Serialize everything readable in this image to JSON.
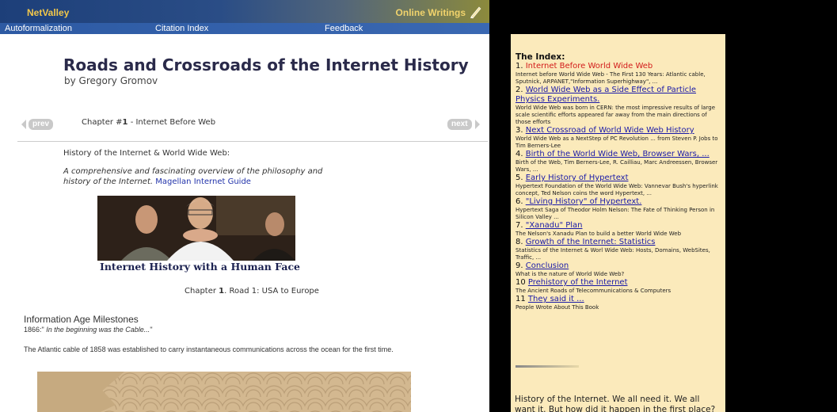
{
  "header": {
    "brand": "NetValley",
    "online_writings": "Online Writings"
  },
  "menu": [
    {
      "label": "Autoformalization"
    },
    {
      "label": "Citation Index"
    },
    {
      "label": "Feedback"
    }
  ],
  "article": {
    "title": "Roads and Crossroads of the Internet History",
    "byline": "by Gregory Gromov",
    "prev_label": "prev",
    "next_label": "next",
    "chapter_prefix": "Chapter #",
    "chapter_num": "1",
    "chapter_title": " - Internet Before Web",
    "history_heading": "History of the Internet & World Wide Web:",
    "quote_text": "A comprehensive and fascinating overview of the philosophy and history of the Internet.",
    "quote_source": "Magellan Internet Guide",
    "photo_caption": "Internet History with a Human Face",
    "road_prefix": "Chapter ",
    "road_num": "1",
    "road_suffix": ". Road 1: USA to Europe",
    "milestones_heading": "Information Age Milestones",
    "milestones_year": "1866:\"",
    "milestones_quote": " In the beginning was the Cable...",
    "milestones_close": "\"",
    "atlantic_text": "The Atlantic cable of 1858 was established to carry instantaneous communications across the ocean for the first time."
  },
  "index": {
    "title": "The Index:",
    "items": [
      {
        "num": "1. ",
        "label": "Internet Before World Wide Web",
        "active": true,
        "desc": "Internet before World Wide Web - The First 130 Years: Atlantic cable, Sputnick, ARPANET,\"Information Superhighway\", ..."
      },
      {
        "num": "2. ",
        "label": "World Wide Web as a Side Effect of Particle Physics Experiments.",
        "active": false,
        "desc": "World Wide Web was born in CERN: the most impressive results of large scale scientific efforts appeared far away from the main directions of those efforts"
      },
      {
        "num": "3. ",
        "label": "Next Crossroad of World Wide Web History",
        "active": false,
        "desc": "World Wide Web as a NextStep of PC Revolution ... from Steven P. Jobs to Tim Berners-Lee"
      },
      {
        "num": "4. ",
        "label": "Birth of the World Wide Web, Browser Wars, ...",
        "active": false,
        "desc": "Birth of the Web, Tim Berners-Lee, R. Cailliau, Marc Andreessen, Browser Wars, ..."
      },
      {
        "num": "5. ",
        "label": "Early History of Hypertext",
        "active": false,
        "desc": "Hypertext Foundation of the World Wide Web: Vannevar Bush's hyperlink concept, Ted Nelson coins the word Hypertext, ..."
      },
      {
        "num": "6. ",
        "label": "\"Living History\" of Hypertext.",
        "active": false,
        "desc": "Hypertext Saga of Theodor Holm Nelson: The Fate of Thinking Person in Silicon Valley ..."
      },
      {
        "num": "7. ",
        "label": "\"Xanadu\" Plan",
        "active": false,
        "desc": "The Nelson's Xanadu Plan to build a better World Wide Web"
      },
      {
        "num": "8. ",
        "label": "Growth of the Internet: Statistics",
        "active": false,
        "desc": "Statistics of the Internet & Worl Wide Web: Hosts, Domains, WebSites, Traffic, ..."
      },
      {
        "num": "9. ",
        "label": "Conclusion",
        "active": false,
        "desc": "What is the nature of World Wide Web?"
      },
      {
        "num": "10 ",
        "label": "Prehistory of the Internet",
        "active": false,
        "desc": "The Ancient Roads of Telecommunications & Computers"
      },
      {
        "num": "11 ",
        "label": "They said it ...",
        "active": false,
        "desc": "People Wrote About This Book"
      }
    ],
    "bottom_text": "History of the Internet. We all need it. We all want it. But how did it happen in the first place?"
  },
  "colors": {
    "index_background": "#fbeabb",
    "active_link": "#d21a1a",
    "link": "#1a1aa8",
    "brand": "#f3c84a"
  }
}
